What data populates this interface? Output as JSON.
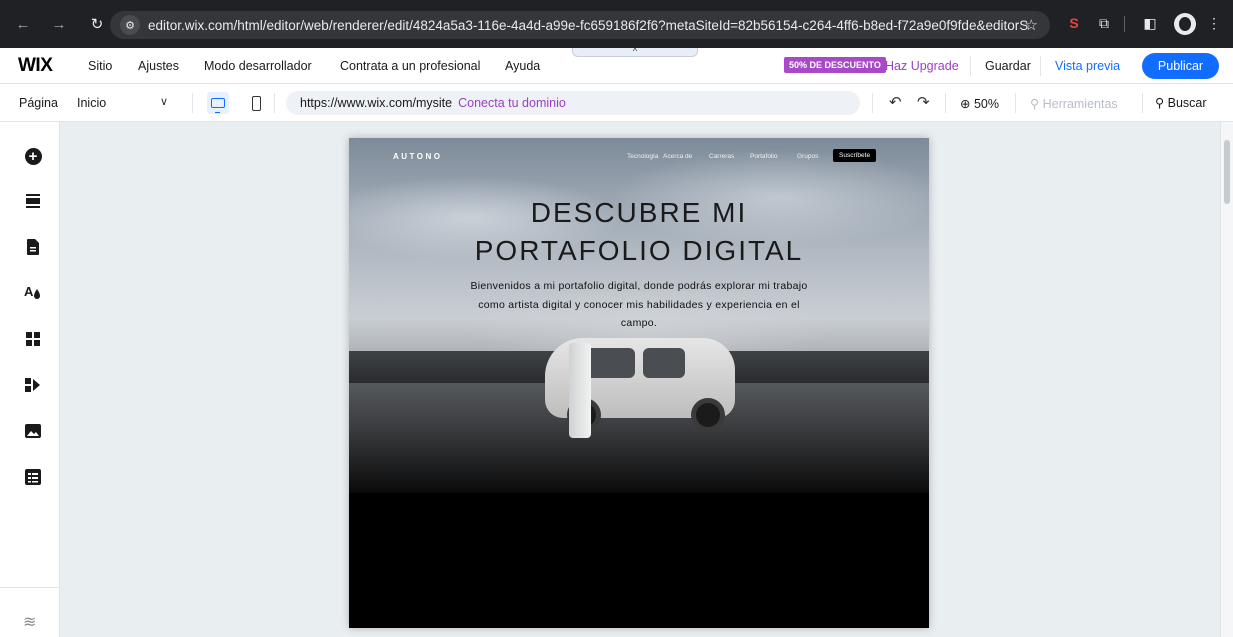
{
  "browser": {
    "url": "editor.wix.com/html/editor/web/renderer/edit/4824a5a3-116e-4a4d-a99e-fc659186f2f6?metaSiteId=82b56154-c264-4ff6-b8ed-f72a9e0f9fde&editorSes..."
  },
  "topbar": {
    "logo": "WIX",
    "menu": [
      "Sitio",
      "Ajustes",
      "Modo desarrollador",
      "Contrata a un profesional",
      "Ayuda"
    ],
    "promo_badge": "50% DE DESCUENTO",
    "upgrade_label": "Haz Upgrade",
    "save_label": "Guardar",
    "preview_label": "Vista previa",
    "publish_label": "Publicar"
  },
  "toolbar": {
    "page_label": "Página",
    "page_value": "Inicio",
    "site_url": "https://www.wix.com/mysite",
    "domain_link": "Conecta tu dominio",
    "zoom": "50%",
    "tools_label": "Herramientas",
    "search_label": "Buscar"
  },
  "site": {
    "brand": "AUTONO",
    "nav": [
      "Tecnología",
      "Acerca de",
      "Carreras",
      "Portafolio",
      "Grupos"
    ],
    "subscribe": "Suscríbete",
    "title_line1": "DESCUBRE MI",
    "title_line2": "PORTAFOLIO DIGITAL",
    "description": "Bienvenidos a mi portafolio digital, donde podrás explorar mi trabajo como artista digital y conocer mis habilidades y experiencia en el campo."
  },
  "colors": {
    "accent": "#116dff",
    "upgrade": "#9d3fc0",
    "canvas": "#e9eef1"
  }
}
